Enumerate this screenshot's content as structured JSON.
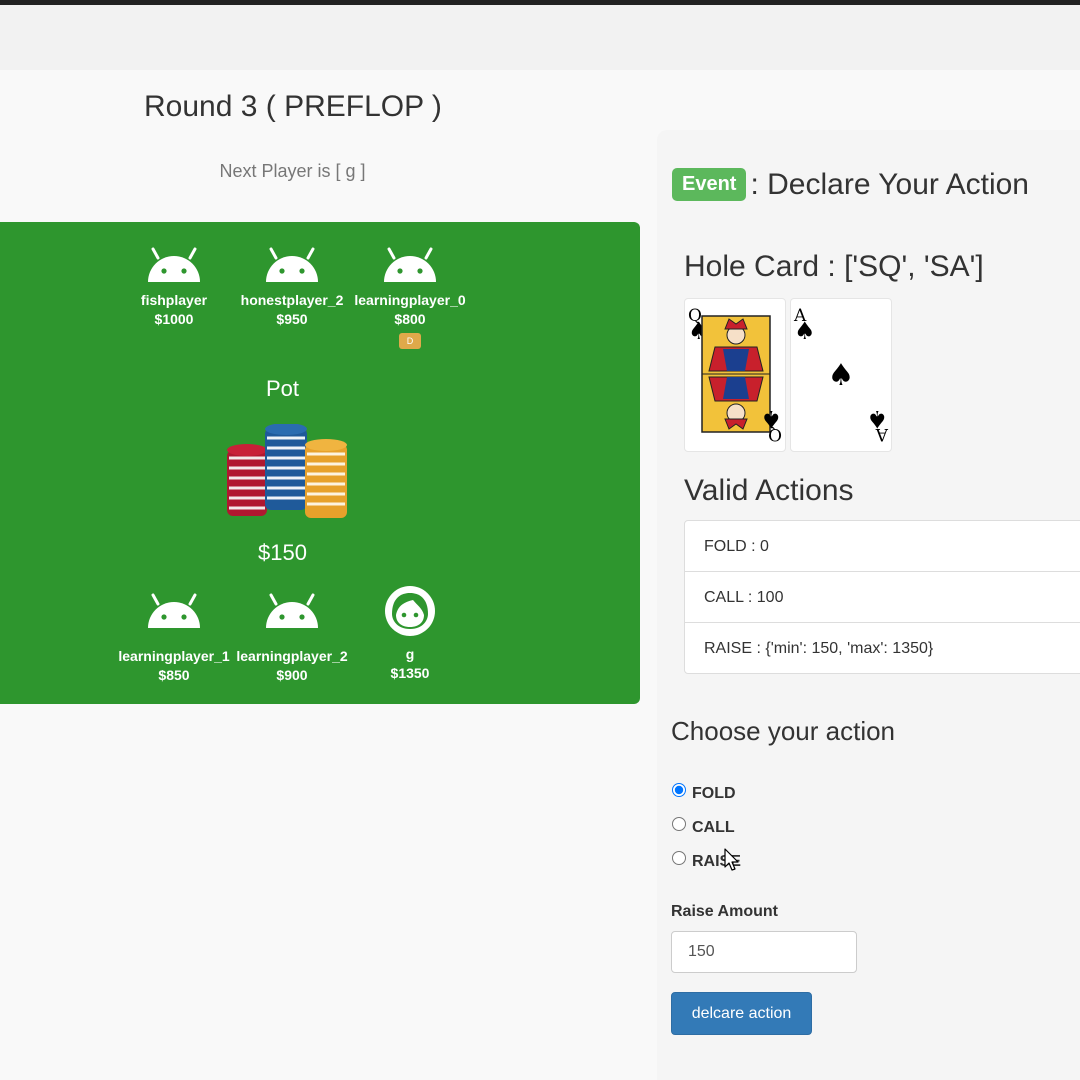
{
  "round": {
    "title": "Round 3 ( PREFLOP )",
    "next_player": "Next Player is [ g ]"
  },
  "table": {
    "top_seats": [
      {
        "name": "fishplayer",
        "stack": "$1000",
        "avatar": "android-icon"
      },
      {
        "name": "honestplayer_2",
        "stack": "$950",
        "avatar": "android-icon"
      },
      {
        "name": "learningplayer_0",
        "stack": "$800",
        "avatar": "android-icon",
        "dealer": "D"
      }
    ],
    "pot_label": "Pot",
    "pot_amount": "$150",
    "bottom_seats": [
      {
        "name": "learningplayer_1",
        "stack": "$850",
        "avatar": "android-icon"
      },
      {
        "name": "learningplayer_2",
        "stack": "$900",
        "avatar": "android-icon"
      },
      {
        "name": "g",
        "stack": "$1350",
        "avatar": "user-face-icon"
      }
    ],
    "color": "#2e962e"
  },
  "event": {
    "badge": "Event",
    "title": ": Declare Your Action"
  },
  "hole_card": {
    "title": "Hole Card : ['SQ', 'SA']",
    "cards": [
      {
        "rank": "Q",
        "suit": "♠"
      },
      {
        "rank": "A",
        "suit": "♠"
      }
    ]
  },
  "valid_actions": {
    "title": "Valid Actions",
    "items": [
      "FOLD : 0",
      "CALL : 100",
      "RAISE : {'min': 150, 'max': 1350}"
    ]
  },
  "choose": {
    "title": "Choose your action",
    "options": [
      {
        "label": "FOLD",
        "checked": true
      },
      {
        "label": "CALL",
        "checked": false
      },
      {
        "label": "RAISE",
        "checked": false
      }
    ]
  },
  "raise": {
    "label": "Raise Amount",
    "value": "150"
  },
  "submit": {
    "label": "delcare action"
  },
  "colors": {
    "badge": "#5cb85c",
    "button": "#337ab7",
    "dealer_chip": "#e0a94a"
  }
}
